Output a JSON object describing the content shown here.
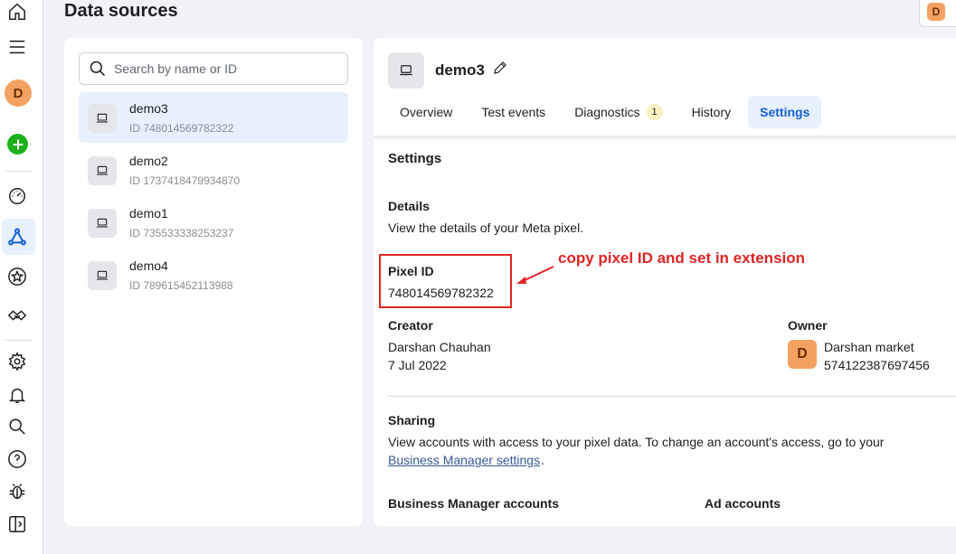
{
  "page": {
    "title": "Data sources"
  },
  "account_avatar": {
    "initial": "D",
    "color": "#f4a261"
  },
  "rail": {
    "avatar_initial": "D",
    "icons": [
      "home-icon",
      "menu-icon",
      "avatar",
      "create-icon",
      "dashboard-icon",
      "data-sources-icon",
      "star-icon",
      "handshake-icon",
      "settings-icon",
      "notifications-icon",
      "search-icon",
      "help-icon",
      "bug-icon",
      "sidebar-toggle-icon"
    ]
  },
  "search": {
    "placeholder": "Search by name or ID",
    "value": ""
  },
  "data_sources": [
    {
      "name": "demo3",
      "id": "ID 748014569782322",
      "selected": true
    },
    {
      "name": "demo2",
      "id": "ID 1737418479934870",
      "selected": false
    },
    {
      "name": "demo1",
      "id": "ID 735533338253237",
      "selected": false
    },
    {
      "name": "demo4",
      "id": "ID 789615452113988",
      "selected": false
    }
  ],
  "detail": {
    "name": "demo3",
    "tabs": [
      {
        "label": "Overview",
        "active": false
      },
      {
        "label": "Test events",
        "active": false
      },
      {
        "label": "Diagnostics",
        "badge": "1",
        "active": false
      },
      {
        "label": "History",
        "active": false
      },
      {
        "label": "Settings",
        "active": true
      }
    ],
    "settings": {
      "section_title": "Settings",
      "details_label": "Details",
      "details_text": "View the details of your Meta pixel.",
      "pixel_id_label": "Pixel ID",
      "pixel_id_value": "748014569782322",
      "annotation": "copy pixel ID and set in extension",
      "creator_label": "Creator",
      "creator_name": "Darshan Chauhan",
      "creator_date": "7 Jul 2022",
      "owner_label": "Owner",
      "owner_initial": "D",
      "owner_name": "Darshan market",
      "owner_id": "574122387697456",
      "sharing_label": "Sharing",
      "sharing_text": "View accounts with access to your pixel data. To change an account's access, go to your",
      "sharing_link": "Business Manager settings",
      "sharing_period": ".",
      "bm_accounts_label": "Business Manager accounts",
      "ad_accounts_label": "Ad accounts"
    }
  },
  "colors": {
    "accent": "#1660d4",
    "selected_bg": "#e7f0fd",
    "annotation": "#e02424",
    "create_button": "#1db01d",
    "badge": "#fcefc2"
  }
}
